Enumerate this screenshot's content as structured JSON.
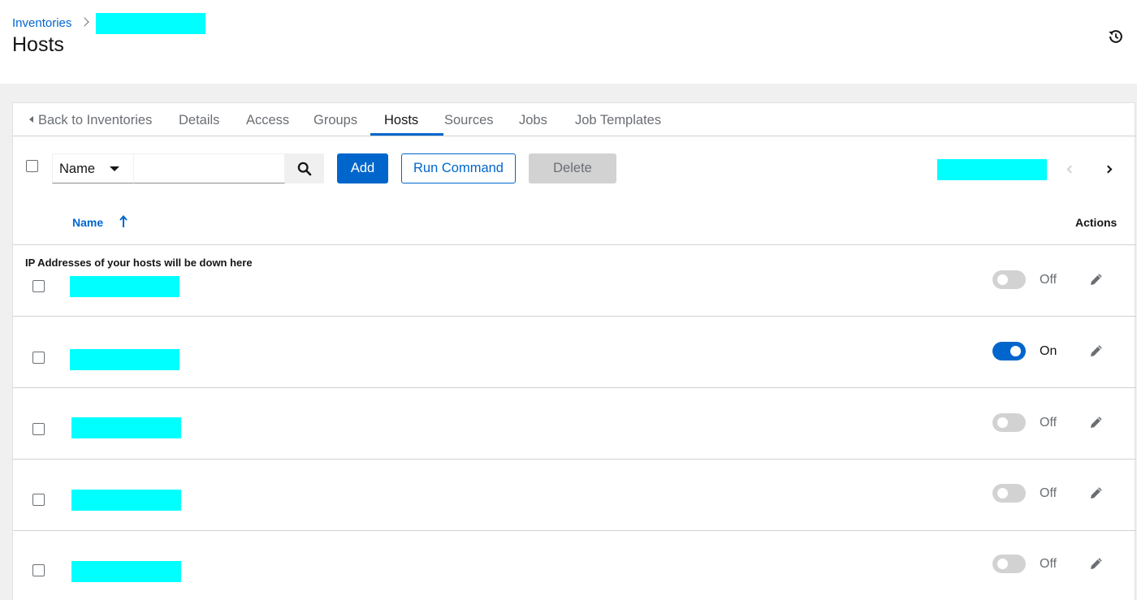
{
  "breadcrumb": {
    "parent": "Inventories"
  },
  "page": {
    "title": "Hosts"
  },
  "icons": {
    "history": "history-icon",
    "search": "search-icon",
    "edit": "pencil-icon",
    "sort": "sort-ascending-icon"
  },
  "colors": {
    "accent": "#0066cc",
    "redaction": "#00ffff",
    "disabled": "#d2d2d2"
  },
  "tabs": [
    {
      "label": "Back to Inventories",
      "active": false
    },
    {
      "label": "Details",
      "active": false
    },
    {
      "label": "Access",
      "active": false
    },
    {
      "label": "Groups",
      "active": false
    },
    {
      "label": "Hosts",
      "active": true
    },
    {
      "label": "Sources",
      "active": false
    },
    {
      "label": "Jobs",
      "active": false
    },
    {
      "label": "Job Templates",
      "active": false
    }
  ],
  "toolbar": {
    "filter_select": "Name",
    "search_value": "",
    "add_label": "Add",
    "run_command_label": "Run Command",
    "delete_label": "Delete"
  },
  "table": {
    "columns": {
      "name": "Name",
      "actions": "Actions"
    },
    "note": "IP Addresses of your hosts will be down here",
    "rows": [
      {
        "enabled": false,
        "toggle_label": "Off"
      },
      {
        "enabled": true,
        "toggle_label": "On"
      },
      {
        "enabled": false,
        "toggle_label": "Off"
      },
      {
        "enabled": false,
        "toggle_label": "Off"
      },
      {
        "enabled": false,
        "toggle_label": "Off"
      }
    ]
  }
}
